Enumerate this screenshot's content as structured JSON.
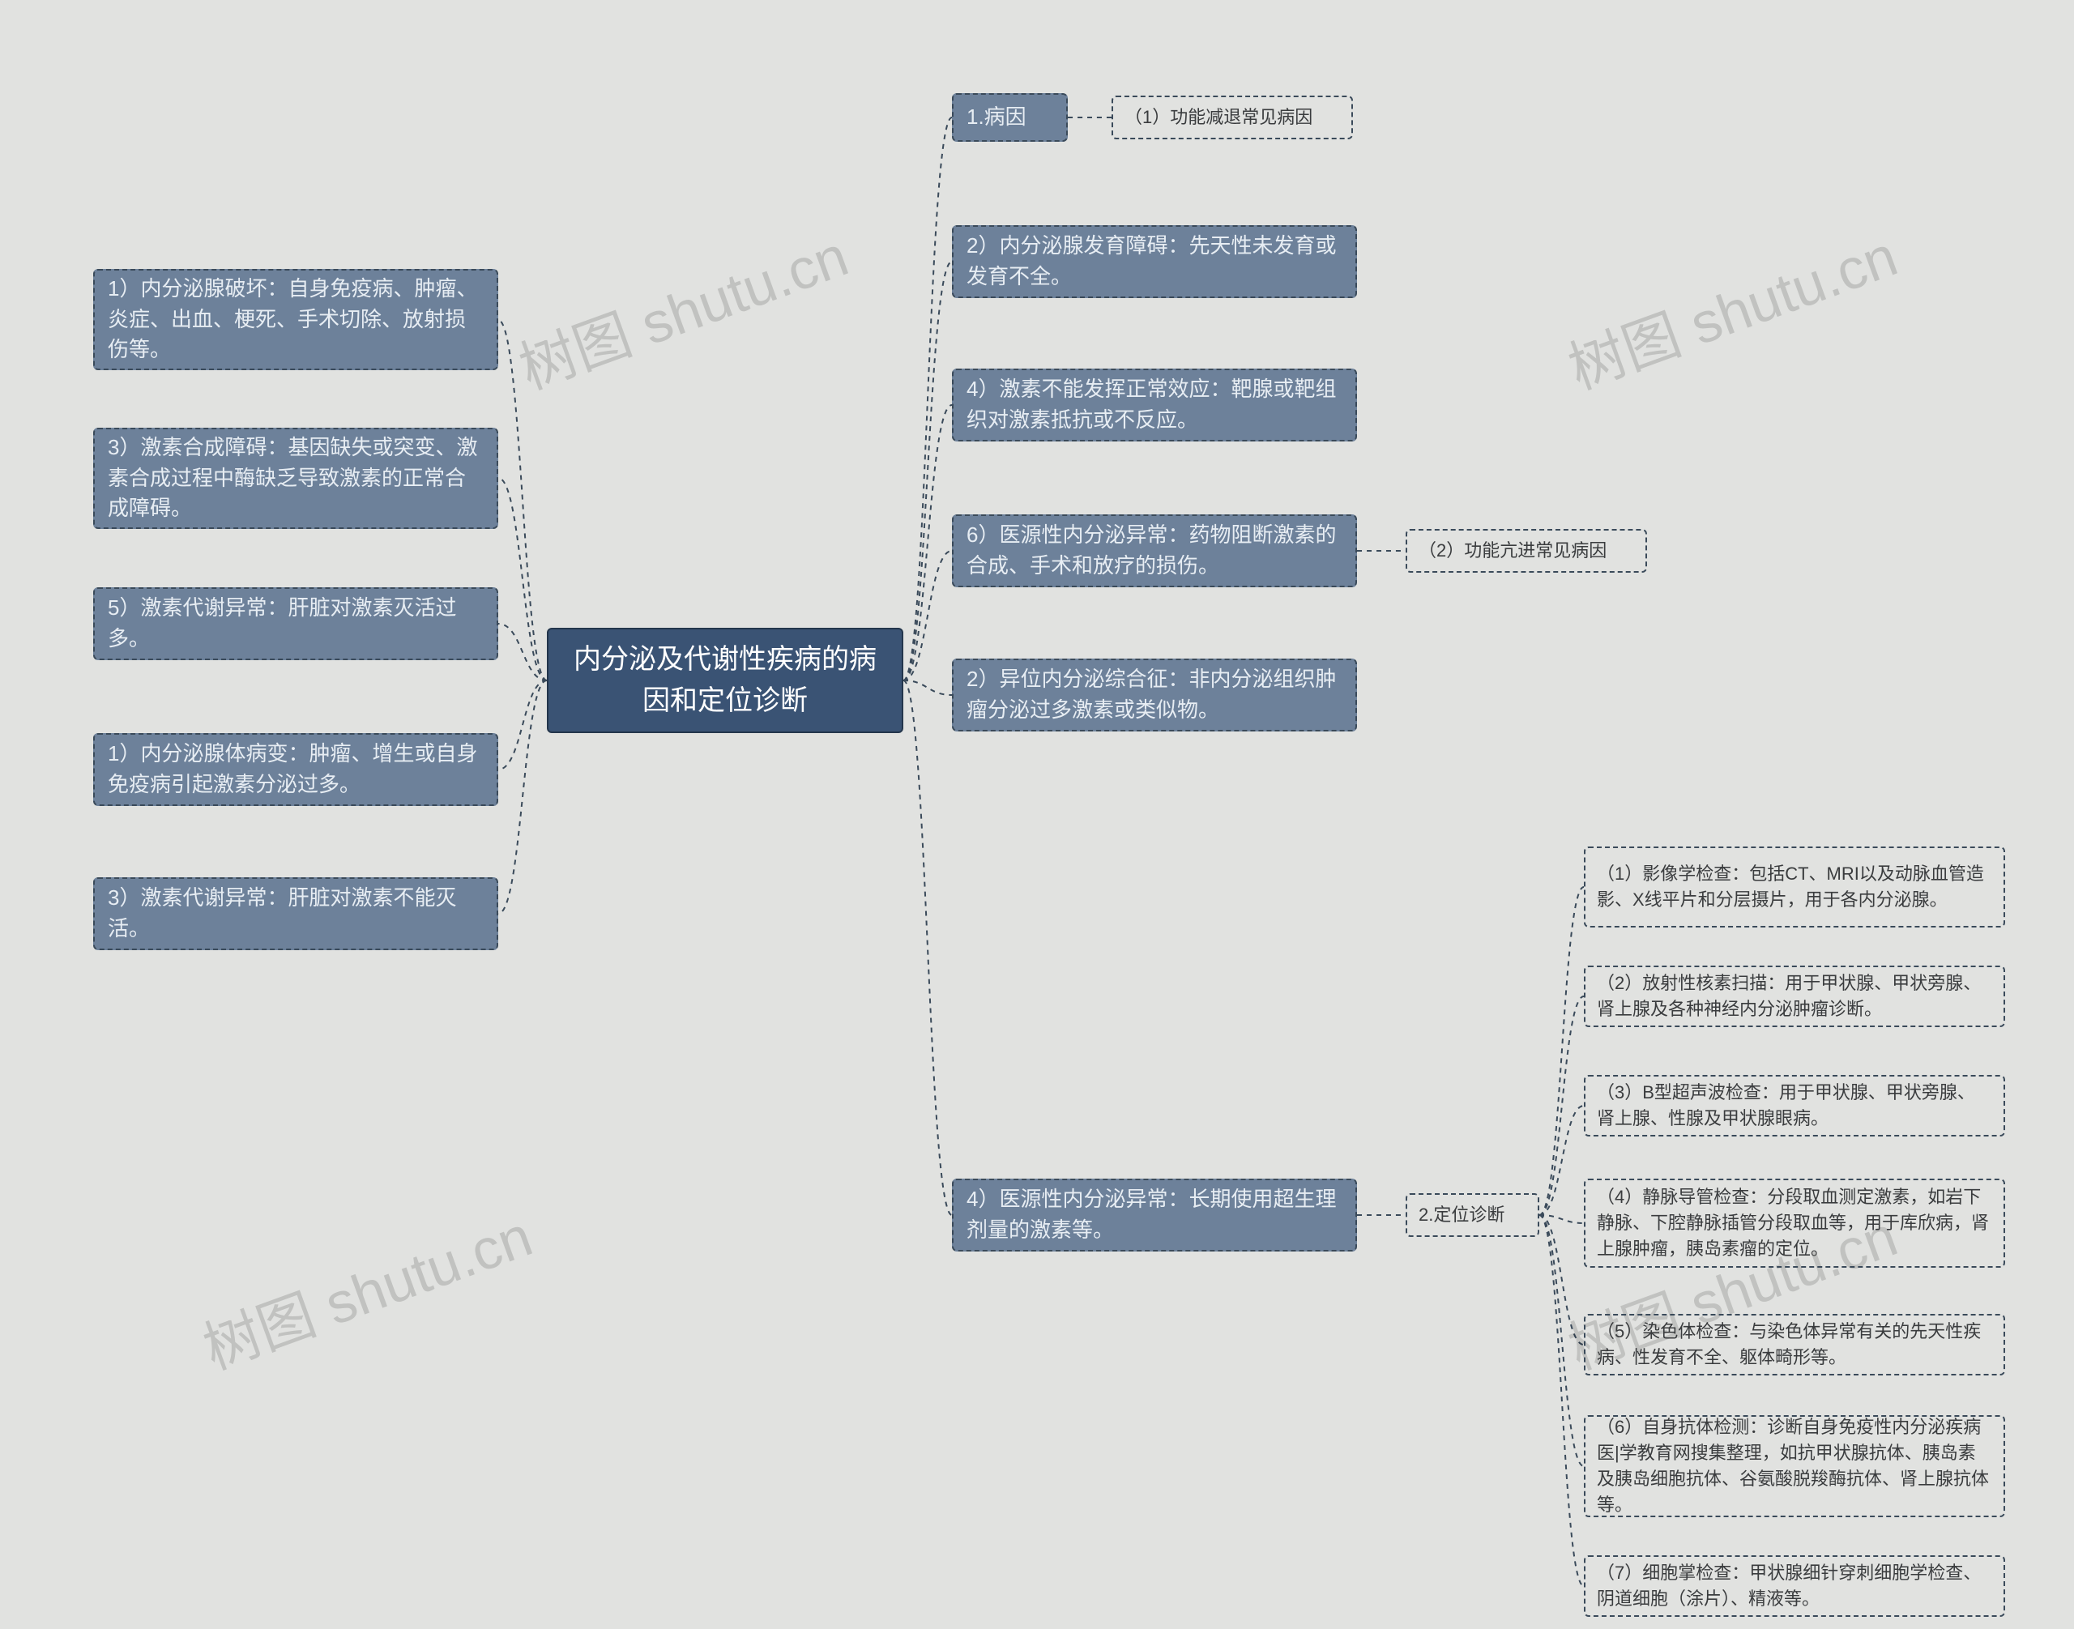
{
  "center": {
    "text": "内分泌及代谢性疾病的病因和定位诊断"
  },
  "left": {
    "l1": "1）内分泌腺破坏：自身免疫病、肿瘤、炎症、出血、梗死、手术切除、放射损伤等。",
    "l2": "3）激素合成障碍：基因缺失或突变、激素合成过程中酶缺乏导致激素的正常合成障碍。",
    "l3": "5）激素代谢异常：肝脏对激素灭活过多。",
    "l4": "1）内分泌腺体病变：肿瘤、增生或自身免疫病引起激素分泌过多。",
    "l5": "3）激素代谢异常：肝脏对激素不能灭活。"
  },
  "right": {
    "r1": "1.病因",
    "r1a": "（1）功能减退常见病因",
    "r2": "2）内分泌腺发育障碍：先天性未发育或发育不全。",
    "r3": "4）激素不能发挥正常效应：靶腺或靶组织对激素抵抗或不反应。",
    "r4": "6）医源性内分泌异常：药物阻断激素的合成、手术和放疗的损伤。",
    "r4a": "（2）功能亢进常见病因",
    "r5": "2）异位内分泌综合征：非内分泌组织肿瘤分泌过多激素或类似物。",
    "r6": "4）医源性内分泌异常：长期使用超生理剂量的激素等。",
    "r6a": "2.定位诊断",
    "diag": {
      "d1": "（1）影像学检查：包括CT、MRI以及动脉血管造影、X线平片和分层摄片，用于各内分泌腺。",
      "d2": "（2）放射性核素扫描：用于甲状腺、甲状旁腺、肾上腺及各种神经内分泌肿瘤诊断。",
      "d3": "（3）B型超声波检查：用于甲状腺、甲状旁腺、肾上腺、性腺及甲状腺眼病。",
      "d4": "（4）静脉导管检查：分段取血测定激素，如岩下静脉、下腔静脉插管分段取血等，用于库欣病，肾上腺肿瘤，胰岛素瘤的定位。",
      "d5": "（5）染色体检查：与染色体异常有关的先天性疾病、性发育不全、躯体畸形等。",
      "d6": "（6）自身抗体检测：诊断自身免疫性内分泌疾病医|学教育网搜集整理，如抗甲状腺抗体、胰岛素及胰岛细胞抗体、谷氨酸脱羧酶抗体、肾上腺抗体等。",
      "d7": "（7）细胞掌检查：甲状腺细针穿刺细胞学检查、阴道细胞（涂片）、精液等。"
    }
  },
  "watermarks": [
    "树图 shutu.cn",
    "树图 shutu.cn",
    "树图 shutu.cn",
    "树图 shutu.cn"
  ]
}
